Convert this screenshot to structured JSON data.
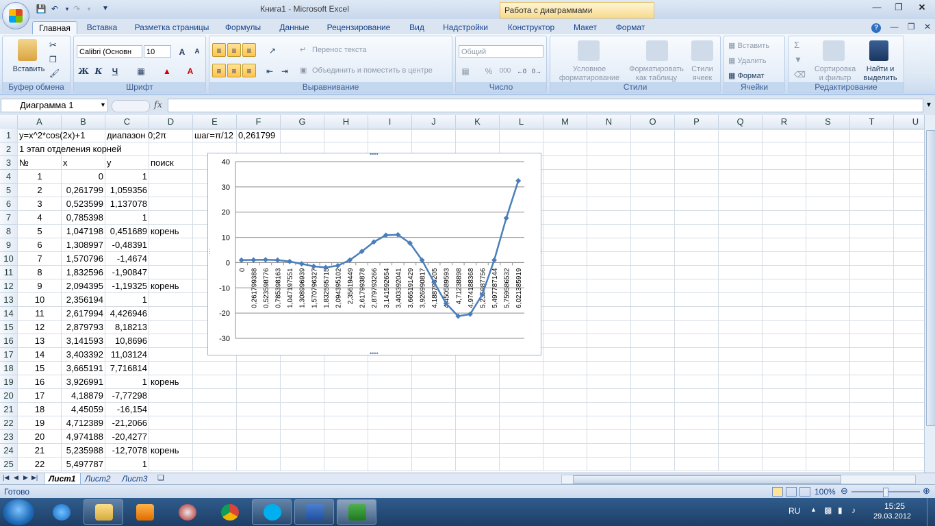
{
  "window": {
    "title": "Книга1 - Microsoft Excel",
    "context_tab_group": "Работа с диаграммами"
  },
  "tabs": [
    "Главная",
    "Вставка",
    "Разметка страницы",
    "Формулы",
    "Данные",
    "Рецензирование",
    "Вид",
    "Надстройки",
    "Конструктор",
    "Макет",
    "Формат"
  ],
  "ribbon": {
    "clipboard": {
      "paste": "Вставить",
      "label": "Буфер обмена"
    },
    "font": {
      "name": "Calibri (Основн",
      "size": "10",
      "bold": "Ж",
      "italic": "К",
      "underline": "Ч",
      "label": "Шрифт"
    },
    "align": {
      "wrap": "Перенос текста",
      "merge": "Объединить и поместить в центре",
      "label": "Выравнивание"
    },
    "number": {
      "format": "Общий",
      "percent": "%",
      "thousands": "000",
      "label": "Число"
    },
    "styles": {
      "cond1": "Условное",
      "cond2": "форматирование",
      "fmt1": "Форматировать",
      "fmt2": "как таблицу",
      "cell1": "Стили",
      "cell2": "ячеек",
      "label": "Стили"
    },
    "cells": {
      "insert": "Вставить",
      "delete": "Удалить",
      "format": "Формат",
      "label": "Ячейки"
    },
    "editing": {
      "sort1": "Сортировка",
      "sort2": "и фильтр",
      "find1": "Найти и",
      "find2": "выделить",
      "label": "Редактирование"
    }
  },
  "formula_bar": {
    "name_box": "Диаграмма 1",
    "fx": "fx",
    "value": ""
  },
  "columns": [
    "A",
    "B",
    "C",
    "D",
    "E",
    "F",
    "G",
    "H",
    "I",
    "J",
    "K",
    "L",
    "M",
    "N",
    "O",
    "P",
    "Q",
    "R",
    "S",
    "T",
    "U"
  ],
  "cells": {
    "r1": {
      "A": "y=x^2*cos(2x)+1",
      "C": "диапазон 0;2π",
      "E": "шаг=π/12",
      "F": "0,261799"
    },
    "r2": {
      "A": "1 этап отделения корней"
    },
    "r3": {
      "A": "№",
      "B": "x",
      "C": "y",
      "D": "поиск"
    }
  },
  "table": [
    {
      "n": "1",
      "x": "0",
      "y": "1",
      "d": ""
    },
    {
      "n": "2",
      "x": "0,261799",
      "y": "1,059356",
      "d": ""
    },
    {
      "n": "3",
      "x": "0,523599",
      "y": "1,137078",
      "d": ""
    },
    {
      "n": "4",
      "x": "0,785398",
      "y": "1",
      "d": ""
    },
    {
      "n": "5",
      "x": "1,047198",
      "y": "0,451689",
      "d": "корень"
    },
    {
      "n": "6",
      "x": "1,308997",
      "y": "-0,48391",
      "d": ""
    },
    {
      "n": "7",
      "x": "1,570796",
      "y": "-1,4674",
      "d": ""
    },
    {
      "n": "8",
      "x": "1,832596",
      "y": "-1,90847",
      "d": ""
    },
    {
      "n": "9",
      "x": "2,094395",
      "y": "-1,19325",
      "d": "корень"
    },
    {
      "n": "10",
      "x": "2,356194",
      "y": "1",
      "d": ""
    },
    {
      "n": "11",
      "x": "2,617994",
      "y": "4,426946",
      "d": ""
    },
    {
      "n": "12",
      "x": "2,879793",
      "y": "8,18213",
      "d": ""
    },
    {
      "n": "13",
      "x": "3,141593",
      "y": "10,8696",
      "d": ""
    },
    {
      "n": "14",
      "x": "3,403392",
      "y": "11,03124",
      "d": ""
    },
    {
      "n": "15",
      "x": "3,665191",
      "y": "7,716814",
      "d": ""
    },
    {
      "n": "16",
      "x": "3,926991",
      "y": "1",
      "d": "корень"
    },
    {
      "n": "17",
      "x": "4,18879",
      "y": "-7,77298",
      "d": ""
    },
    {
      "n": "18",
      "x": "4,45059",
      "y": "-16,154",
      "d": ""
    },
    {
      "n": "19",
      "x": "4,712389",
      "y": "-21,2066",
      "d": ""
    },
    {
      "n": "20",
      "x": "4,974188",
      "y": "-20,4277",
      "d": ""
    },
    {
      "n": "21",
      "x": "5,235988",
      "y": "-12,7078",
      "d": "корень"
    },
    {
      "n": "22",
      "x": "5,497787",
      "y": "1",
      "d": ""
    }
  ],
  "chart_data": {
    "type": "line",
    "categories": [
      "0",
      "0,261799388",
      "0,523598776",
      "0,785398163",
      "1,047197551",
      "1,308996939",
      "1,570796327",
      "1,832595715",
      "2,094395102",
      "2,35619449",
      "2,617993878",
      "2,879793266",
      "3,141592654",
      "3,403392041",
      "3,665191429",
      "3,926990817",
      "4,188790205",
      "4,450589593",
      "4,71238898",
      "4,974188368",
      "5,235987756",
      "5,497787144",
      "5,759586532",
      "6,021385919"
    ],
    "values": [
      1,
      1.059356,
      1.137078,
      1,
      0.451689,
      -0.48391,
      -1.4674,
      -1.90847,
      -1.19325,
      1,
      4.426946,
      8.18213,
      10.8696,
      11.03124,
      7.716814,
      1,
      -7.77298,
      -16.154,
      -21.2066,
      -20.4277,
      -12.7078,
      1,
      17.6,
      32.4
    ],
    "ylim": [
      -30,
      40
    ],
    "yticks": [
      "40",
      "30",
      "20",
      "10",
      "0",
      "-10",
      "-20",
      "-30"
    ],
    "grid": true,
    "series_color": "#4a7ebb"
  },
  "sheets": [
    "Лист1",
    "Лист2",
    "Лист3"
  ],
  "status": {
    "ready": "Готово",
    "zoom": "100%"
  },
  "taskbar": {
    "lang": "RU",
    "time": "15:25",
    "date": "29.03.2012"
  }
}
